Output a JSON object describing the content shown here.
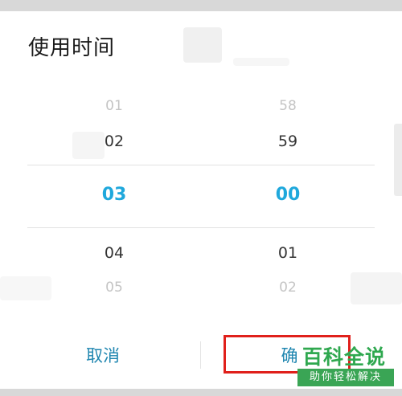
{
  "dialog": {
    "title": "使用时间",
    "hours": {
      "far_top": "01",
      "near_top": "02",
      "selected": "03",
      "near_bottom": "04",
      "far_bottom": "05"
    },
    "minutes": {
      "far_top": "58",
      "near_top": "59",
      "selected": "00",
      "near_bottom": "01",
      "far_bottom": "02"
    },
    "cancel_label": "取消",
    "confirm_label": "确"
  },
  "watermark": {
    "main": "百科全说",
    "sub": "助你轻松解决"
  },
  "colors": {
    "accent": "#1fa8dc",
    "button_text": "#1f86b0",
    "highlight": "#e0201b",
    "watermark_green": "#2fa84f"
  }
}
